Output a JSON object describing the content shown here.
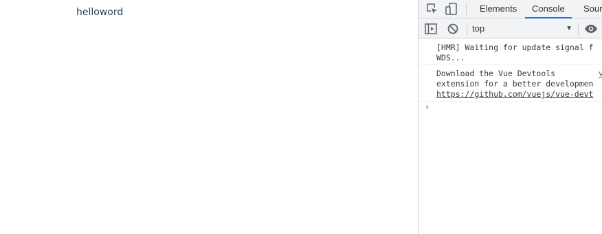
{
  "page": {
    "text": "helloword"
  },
  "devtools": {
    "tabs": [
      {
        "label": "Elements"
      },
      {
        "label": "Console"
      },
      {
        "label": "Sour"
      }
    ],
    "console_toolbar": {
      "context": "top"
    },
    "messages": [
      {
        "line1": "[HMR] Waiting for update signal f",
        "line2": "WDS..."
      },
      {
        "line1": "Download the Vue Devtools",
        "line2": "extension for a better developmen",
        "line3": "https://github.com/vuejs/vue-devt",
        "source": "v"
      }
    ],
    "prompt": "›"
  },
  "colors": {
    "accent": "#1a73e8",
    "toolbar_bg": "#f1f3f4",
    "page_text": "#2c3e50"
  }
}
